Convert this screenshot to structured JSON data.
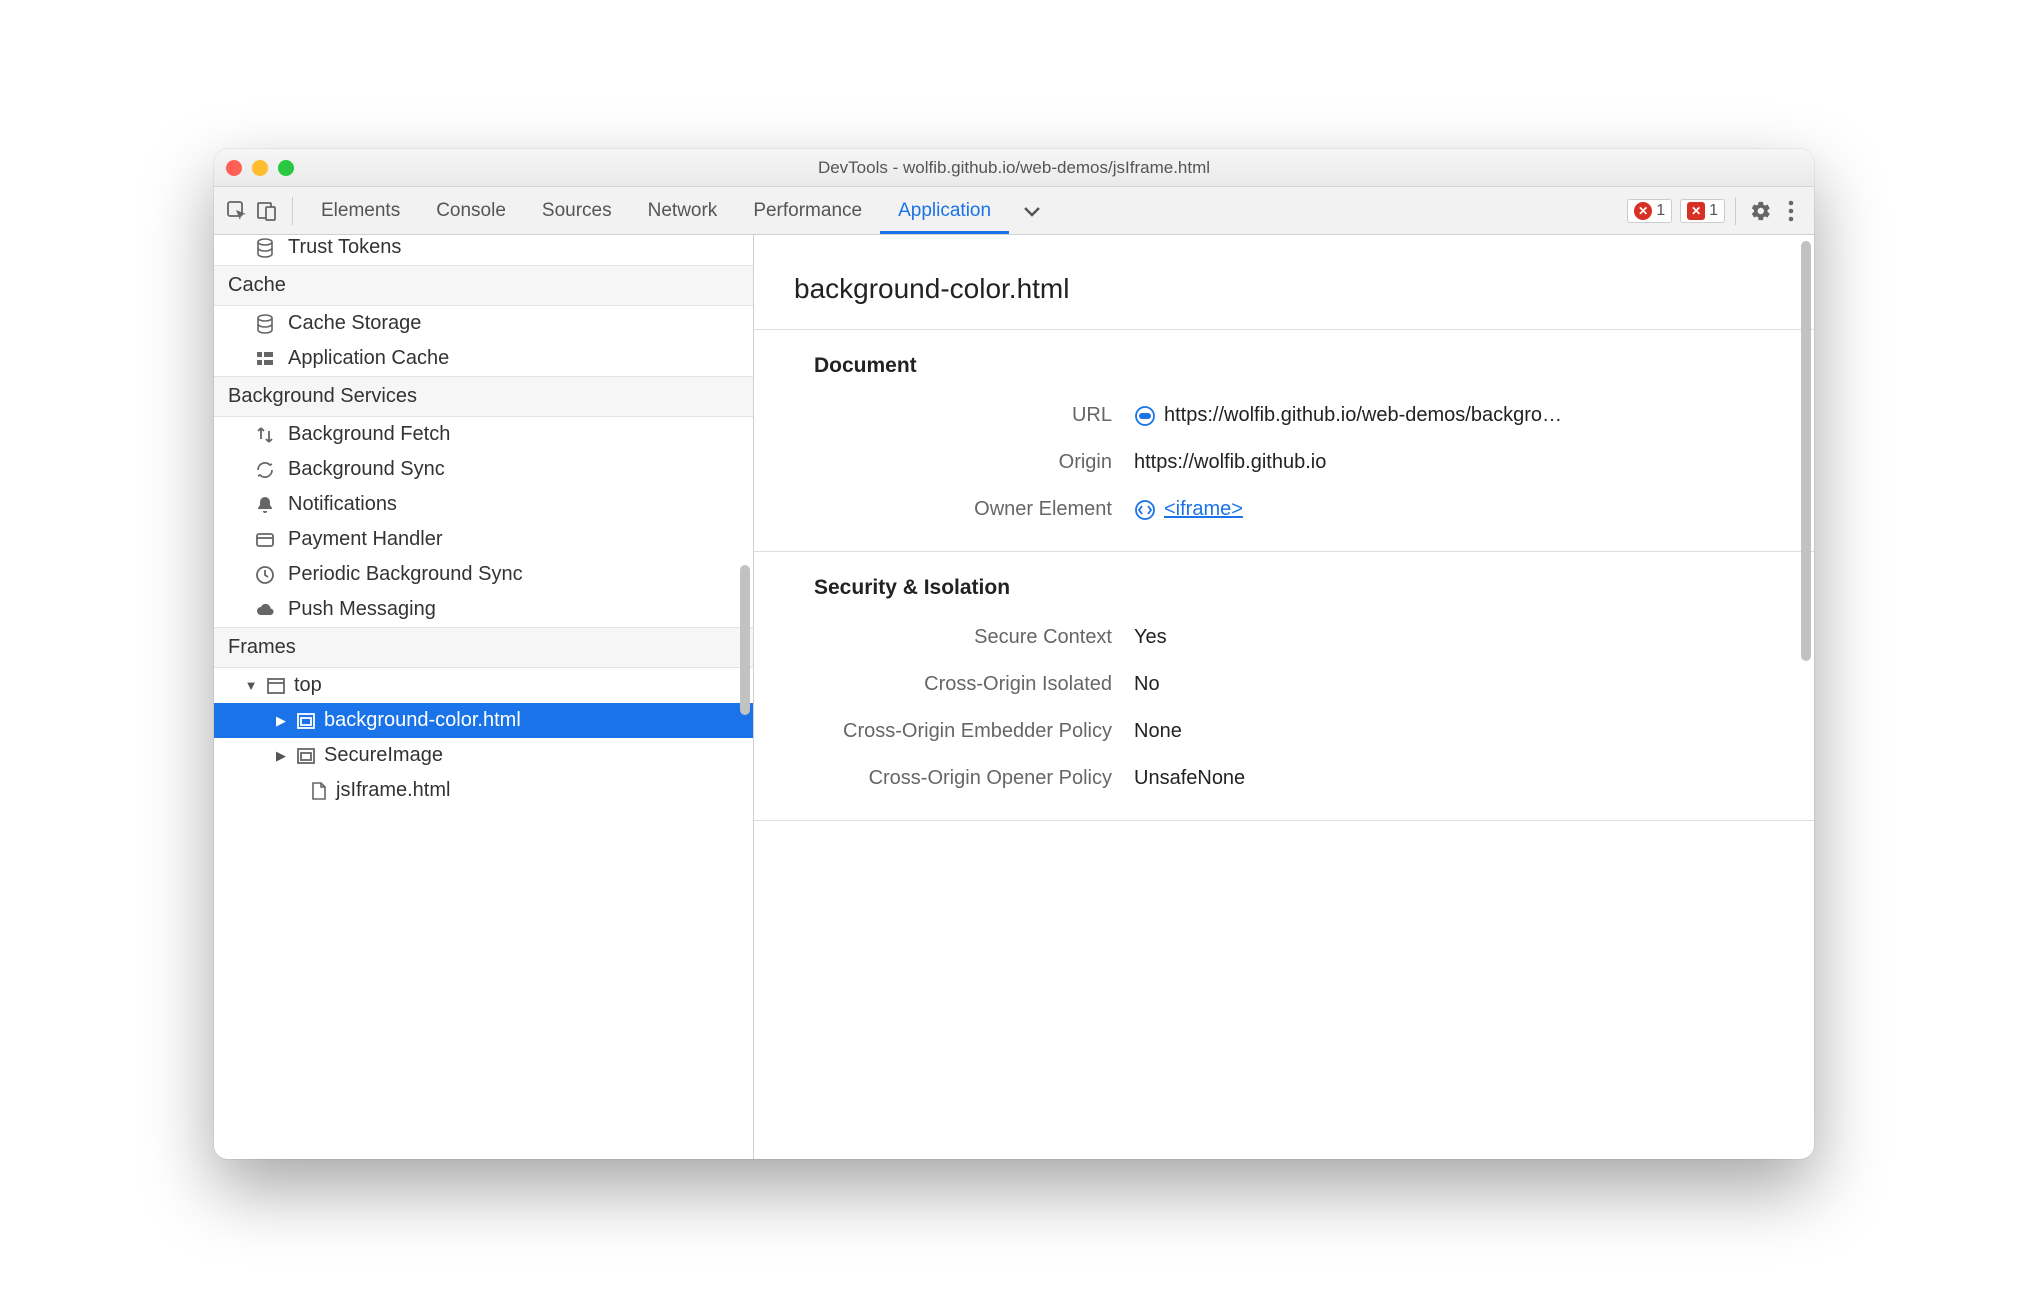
{
  "window": {
    "title": "DevTools - wolfib.github.io/web-demos/jsIframe.html"
  },
  "toolbar": {
    "tabs": [
      "Elements",
      "Console",
      "Sources",
      "Network",
      "Performance",
      "Application"
    ],
    "active_index": 5,
    "error_badge_count": "1",
    "issue_badge_count": "1"
  },
  "sidebar": {
    "storage_item": "Trust Tokens",
    "cache": {
      "header": "Cache",
      "items": [
        "Cache Storage",
        "Application Cache"
      ]
    },
    "bg": {
      "header": "Background Services",
      "items": [
        "Background Fetch",
        "Background Sync",
        "Notifications",
        "Payment Handler",
        "Periodic Background Sync",
        "Push Messaging"
      ]
    },
    "frames": {
      "header": "Frames",
      "top": "top",
      "children": [
        "background-color.html",
        "SecureImage",
        "jsIframe.html"
      ],
      "selected_index": 0
    }
  },
  "detail": {
    "title": "background-color.html",
    "document": {
      "header": "Document",
      "rows": {
        "url_label": "URL",
        "url_value": "https://wolfib.github.io/web-demos/backgro…",
        "origin_label": "Origin",
        "origin_value": "https://wolfib.github.io",
        "owner_label": "Owner Element",
        "owner_value": "<iframe>"
      }
    },
    "security": {
      "header": "Security & Isolation",
      "rows": {
        "secure_label": "Secure Context",
        "secure_value": "Yes",
        "coi_label": "Cross-Origin Isolated",
        "coi_value": "No",
        "coep_label": "Cross-Origin Embedder Policy",
        "coep_value": "None",
        "coop_label": "Cross-Origin Opener Policy",
        "coop_value": "UnsafeNone"
      }
    }
  }
}
